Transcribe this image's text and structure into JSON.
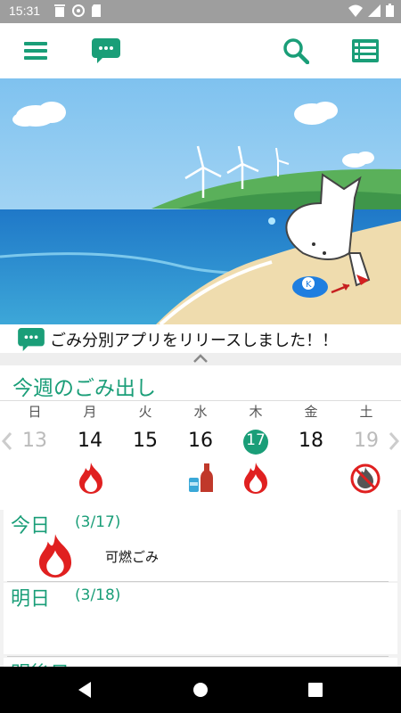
{
  "status_bar": {
    "time": "15:31"
  },
  "news": {
    "text": "ごみ分別アプリをリリースしました！！"
  },
  "week": {
    "title": "今週のごみ出し",
    "days": [
      "日",
      "月",
      "火",
      "水",
      "木",
      "金",
      "土"
    ],
    "dates": [
      "13",
      "14",
      "15",
      "16",
      "17",
      "18",
      "19"
    ],
    "today_index": 4,
    "garbage": [
      {
        "day": "月",
        "icon": "fire-icon"
      },
      {
        "day": "水",
        "icon": "bottle-can-icon"
      },
      {
        "day": "木",
        "icon": "fire-icon"
      },
      {
        "day": "土",
        "icon": "no-fire-icon"
      }
    ]
  },
  "today": {
    "label": "今日",
    "date": "(3/17)",
    "item": "可燃ごみ",
    "icon": "fire-icon"
  },
  "tomorrow": {
    "label": "明日",
    "date": "(3/18)"
  },
  "day_after": {
    "label": "明後日"
  },
  "colors": {
    "accent": "#1a9e78",
    "fire": "#e02020"
  }
}
